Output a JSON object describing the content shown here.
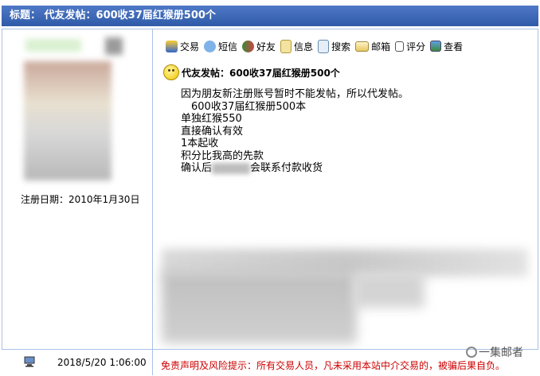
{
  "title": {
    "label": "标题：",
    "text": "代友发帖：600收37届红猴册500个"
  },
  "user": {
    "reg_date": "注册日期：2010年1月30日"
  },
  "toolbar": {
    "items": [
      {
        "label": "交易",
        "icon": "shield-icon"
      },
      {
        "label": "短信",
        "icon": "message-icon"
      },
      {
        "label": "好友",
        "icon": "friends-icon"
      },
      {
        "label": "信息",
        "icon": "info-icon"
      },
      {
        "label": "搜索",
        "icon": "search-icon"
      },
      {
        "label": "邮箱",
        "icon": "mail-icon"
      },
      {
        "label": "评分",
        "icon": "rate-icon"
      },
      {
        "label": "查看",
        "icon": "view-icon"
      }
    ]
  },
  "post": {
    "title": "代友发帖：600收37届红猴册500个",
    "lines": [
      "因为朋友新注册账号暂时不能发帖，所以代发帖。",
      "　600收37届红猴册500本",
      "单独红猴550",
      "直接确认有效",
      "1本起收",
      "积分比我高的先款",
      "确认后",
      "会联系付款收货"
    ]
  },
  "footer": {
    "time": "2018/5/20 1:06:00",
    "disclaimer": "免责声明及风险提示：所有交易人员，凡未采用本站中介交易的，被骗后果自负。"
  },
  "watermark": "一集邮者",
  "colors": {
    "title_bg": "#3a64b4",
    "border": "#a9c2e6",
    "disclaimer": "#cc0000"
  }
}
